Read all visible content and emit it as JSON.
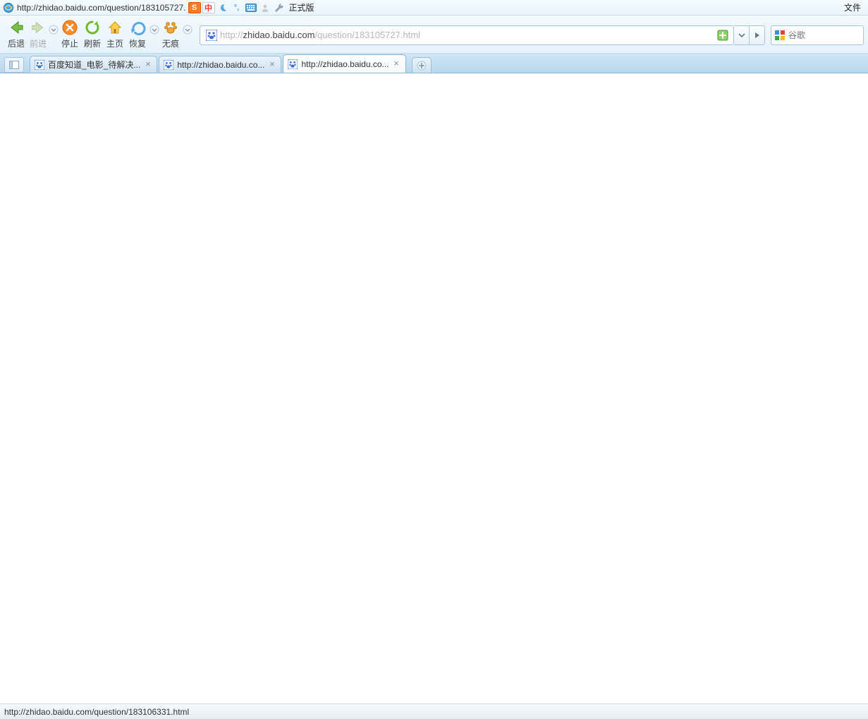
{
  "titlebar": {
    "url_text": "http://zhidao.baidu.com/question/183105727.",
    "mode_text": "正式版",
    "menu_file": "文件",
    "ime": {
      "s_label": "S",
      "zhong_label": "中"
    }
  },
  "toolbar": {
    "back_label": "后退",
    "forward_label": "前进",
    "stop_label": "停止",
    "refresh_label": "刷新",
    "home_label": "主页",
    "restore_label": "恢复",
    "incognito_label": "无痕"
  },
  "address": {
    "prefix": "http://",
    "host": "zhidao.baidu.com",
    "path": "/question/183105727.html"
  },
  "search": {
    "placeholder": "谷歌"
  },
  "tabs": [
    {
      "label": "百度知道_电影_待解决...",
      "active": false
    },
    {
      "label": "http://zhidao.baidu.co...",
      "active": false
    },
    {
      "label": "http://zhidao.baidu.co...",
      "active": true
    }
  ],
  "status": {
    "text": "http://zhidao.baidu.com/question/183106331.html"
  }
}
